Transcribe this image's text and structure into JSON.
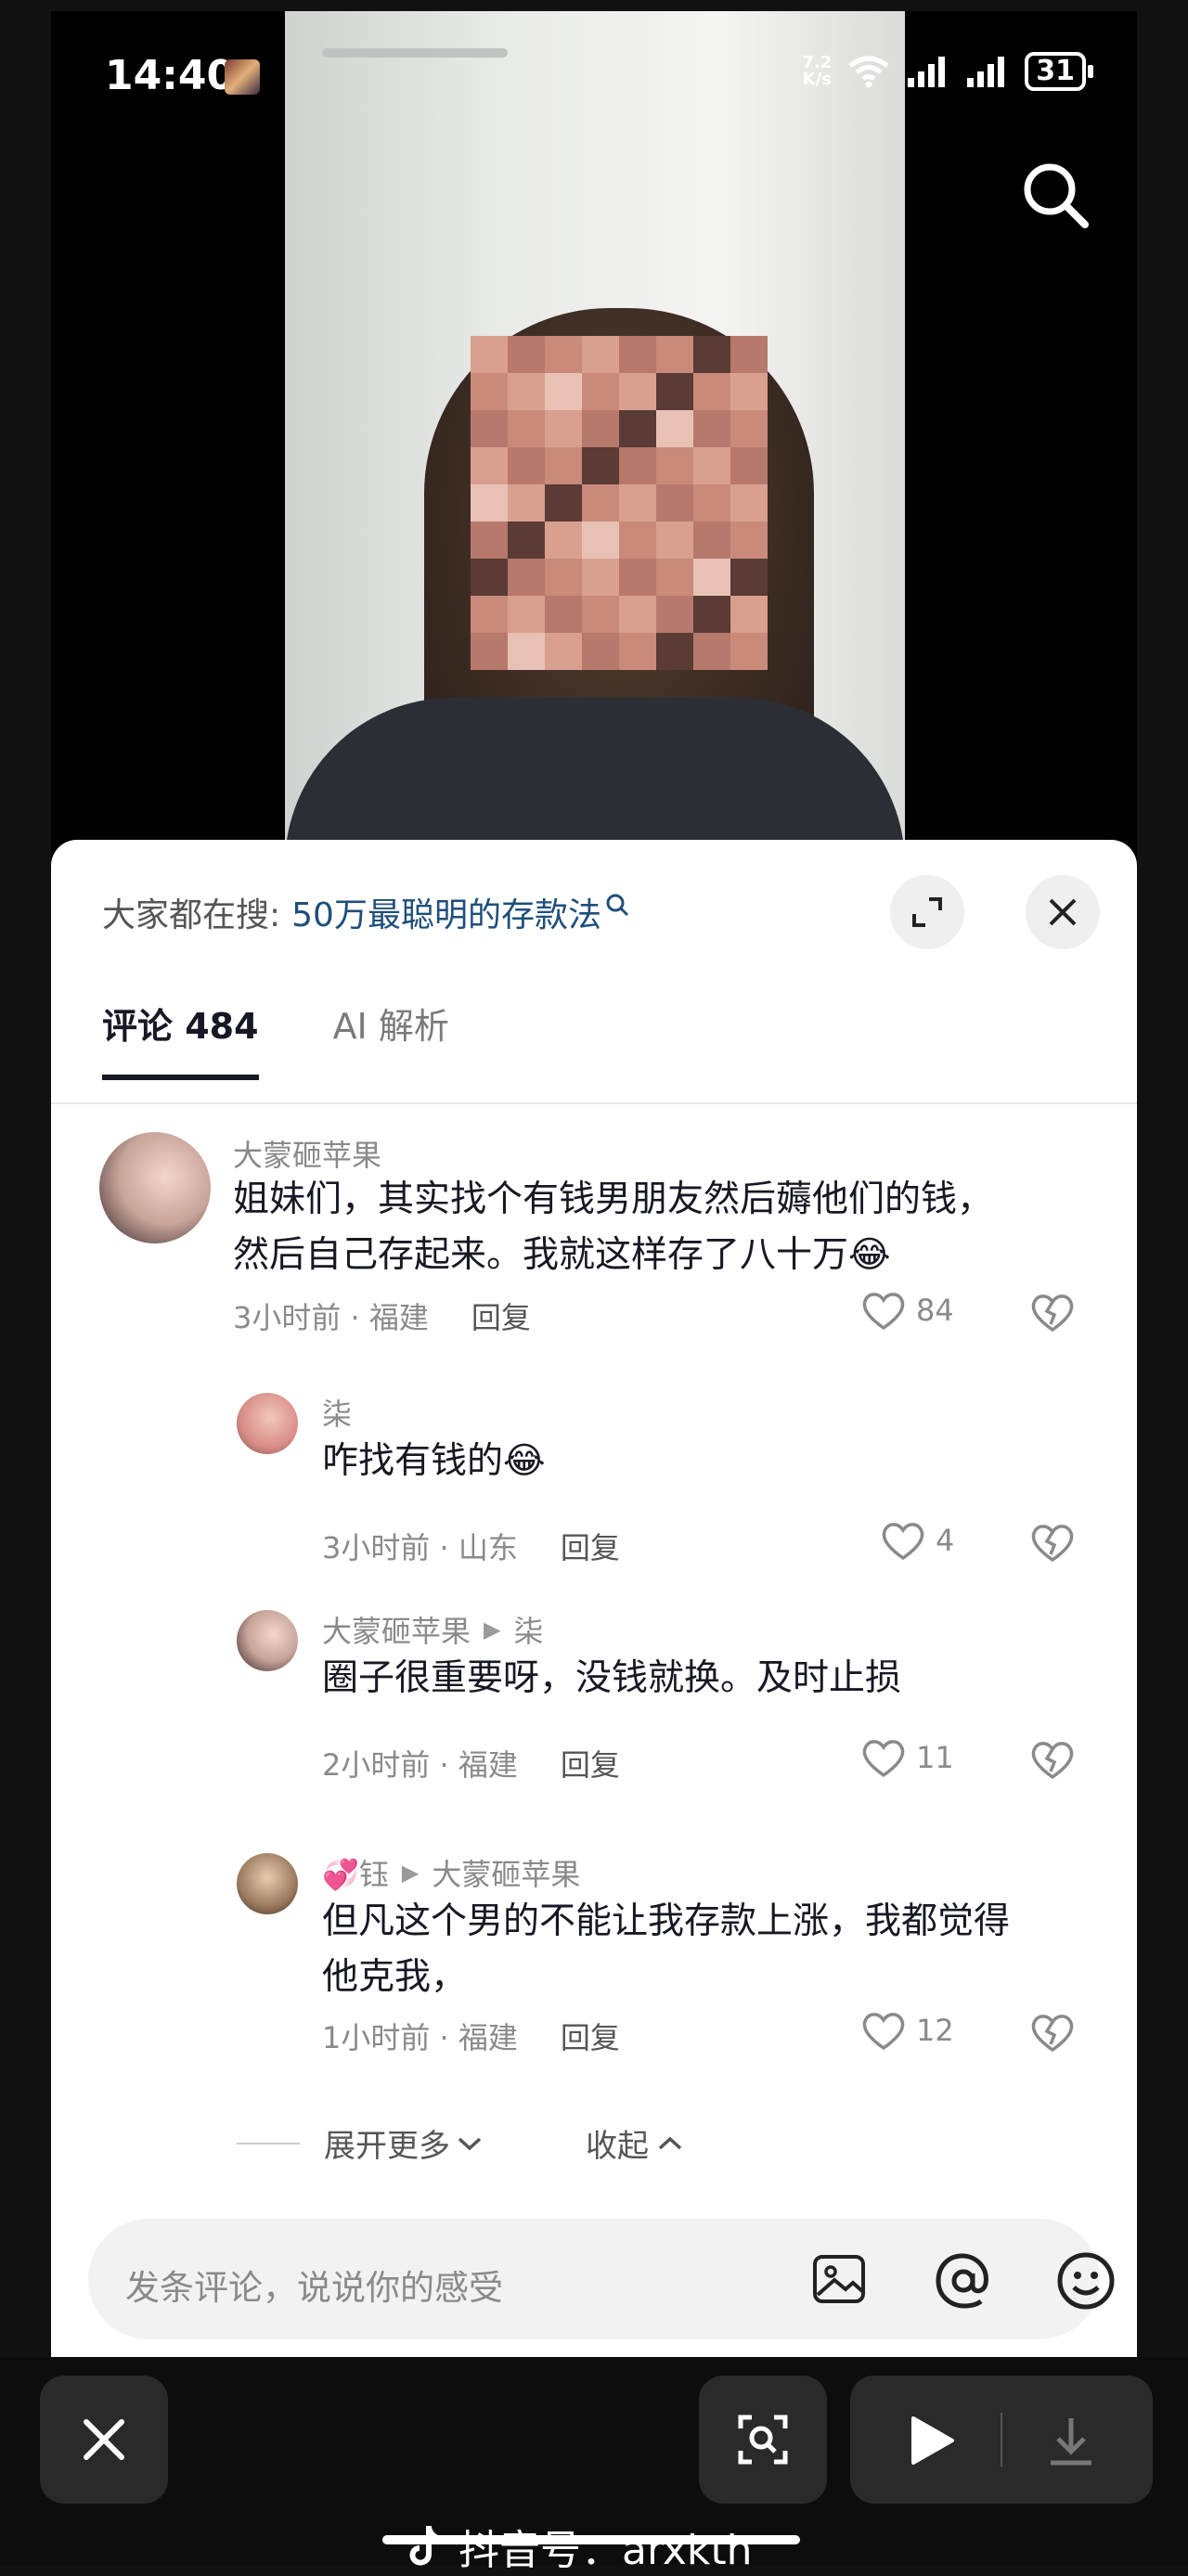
{
  "status": {
    "time": "14:40",
    "speed_top": "7.2",
    "speed_bottom": "K/s",
    "battery": "31"
  },
  "hot_search": {
    "prefix": "大家都在搜:",
    "term": "50万最聪明的存款法"
  },
  "tabs": [
    {
      "label": "评论 484"
    },
    {
      "label": "AI 解析"
    }
  ],
  "comments": [
    {
      "user": "大蒙砸苹果",
      "text_lines": [
        "姐妹们，其实找个有钱男朋友然后薅他们的钱，",
        "然后自己存起来。我就这样存了八十万😂"
      ],
      "time_loc": "3小时前 · 福建",
      "reply": "回复",
      "likes": "84"
    },
    {
      "user": "柒",
      "text_lines": [
        "咋找有钱的😂"
      ],
      "time_loc": "3小时前 · 山东",
      "reply": "回复",
      "likes": "4"
    },
    {
      "user": "大蒙砸苹果",
      "reply_to": "柒",
      "text_lines": [
        "圈子很重要呀，没钱就换。及时止损"
      ],
      "time_loc": "2小时前 · 福建",
      "reply": "回复",
      "likes": "11"
    },
    {
      "user": "💞钰",
      "reply_to": "大蒙砸苹果",
      "text_lines": [
        "但凡这个男的不能让我存款上涨，我都觉得",
        "他克我，"
      ],
      "time_loc": "1小时前 · 福建",
      "reply": "回复",
      "likes": "12"
    }
  ],
  "expand_more": "展开更多",
  "collapse": "收起",
  "input_placeholder": "发条评论，说说你的感受",
  "watermark": "抖音号：arxkth",
  "colors": {
    "accent_link": "#1f4f7a",
    "text_primary": "#161823",
    "text_secondary": "#8a8a8a"
  }
}
